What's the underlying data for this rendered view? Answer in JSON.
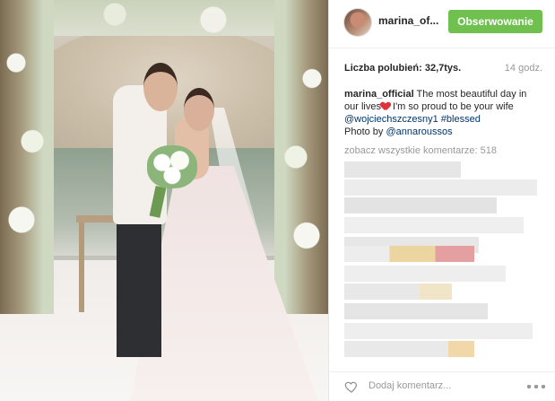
{
  "header": {
    "username": "marina_of...",
    "follow_label": "Obserwowanie"
  },
  "stats": {
    "likes_label": "Liczba polubień: 32,7tys.",
    "time": "14 godz."
  },
  "caption": {
    "username": "marina_official",
    "text_1": " The most beautiful day in our lives",
    "text_2": " I'm so proud to be your wife",
    "mention": "@wojciechszczesny1",
    "hashtag": " #blessed",
    "photo_by": "Photo by ",
    "photo_mention": "@annaroussos",
    "emoji": "red-heart-emoji"
  },
  "comments": {
    "view_all_label": "zobacz wszystkie komentarze: 518",
    "blurred": true
  },
  "footer": {
    "add_comment_placeholder": "Dodaj komentarz..."
  },
  "colors": {
    "follow_button": "#70c050",
    "link": "#003569",
    "muted": "#999999"
  },
  "icons": {
    "like": "heart-outline-icon",
    "more": "more-options-icon"
  }
}
